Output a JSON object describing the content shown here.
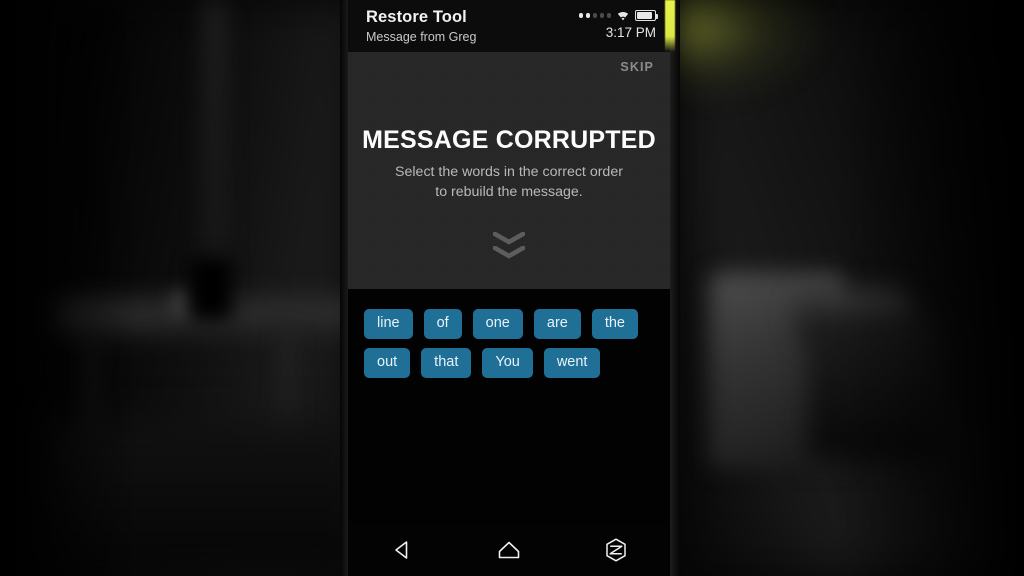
{
  "scene": {
    "description": "dark blurred living room behind phone",
    "accent_edge_color": "#e9f24a"
  },
  "phone": {
    "header": {
      "app_title": "Restore Tool",
      "subtitle": "Message from Greg",
      "status": {
        "signal_icon": "signal-dots-icon",
        "signal_dots_total": 5,
        "signal_dots_filled": 2,
        "wifi_icon": "wifi-icon",
        "battery_icon": "battery-icon",
        "battery_level_pct": 88,
        "clock": "3:17 PM"
      }
    },
    "panel": {
      "skip_label": "SKIP",
      "title": "MESSAGE CORRUPTED",
      "instructions_line1": "Select the words in the correct order",
      "instructions_line2": "to rebuild the message.",
      "scroll_hint_icon": "double-chevron-down-icon",
      "panel_bg": "#272727"
    },
    "tray": {
      "chip_color": "#1f6f96",
      "words": [
        "line",
        "of",
        "one",
        "are",
        "the",
        "out",
        "that",
        "You",
        "went"
      ]
    },
    "navbar": {
      "back_icon": "back-triangle-icon",
      "home_icon": "home-outline-icon",
      "recents_icon": "recents-hexagon-icon"
    }
  }
}
